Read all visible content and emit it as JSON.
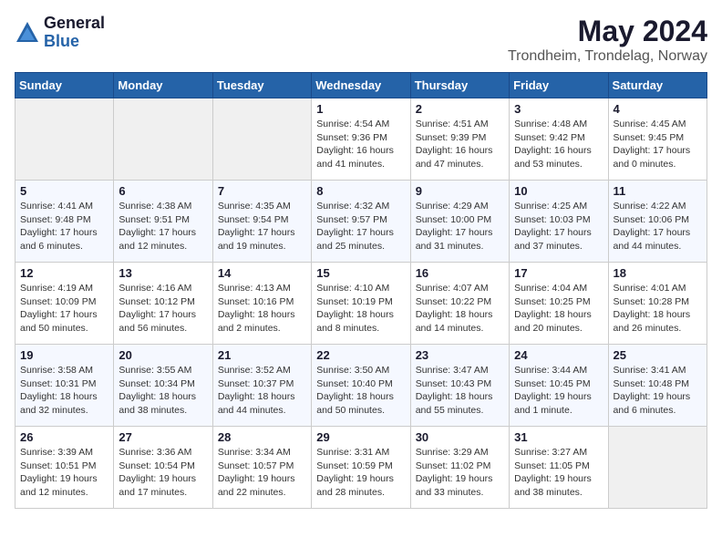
{
  "logo": {
    "general": "General",
    "blue": "Blue"
  },
  "header": {
    "month_year": "May 2024",
    "location": "Trondheim, Trondelag, Norway"
  },
  "days_of_week": [
    "Sunday",
    "Monday",
    "Tuesday",
    "Wednesday",
    "Thursday",
    "Friday",
    "Saturday"
  ],
  "weeks": [
    [
      {
        "day": "",
        "info": ""
      },
      {
        "day": "",
        "info": ""
      },
      {
        "day": "",
        "info": ""
      },
      {
        "day": "1",
        "info": "Sunrise: 4:54 AM\nSunset: 9:36 PM\nDaylight: 16 hours and 41 minutes."
      },
      {
        "day": "2",
        "info": "Sunrise: 4:51 AM\nSunset: 9:39 PM\nDaylight: 16 hours and 47 minutes."
      },
      {
        "day": "3",
        "info": "Sunrise: 4:48 AM\nSunset: 9:42 PM\nDaylight: 16 hours and 53 minutes."
      },
      {
        "day": "4",
        "info": "Sunrise: 4:45 AM\nSunset: 9:45 PM\nDaylight: 17 hours and 0 minutes."
      }
    ],
    [
      {
        "day": "5",
        "info": "Sunrise: 4:41 AM\nSunset: 9:48 PM\nDaylight: 17 hours and 6 minutes."
      },
      {
        "day": "6",
        "info": "Sunrise: 4:38 AM\nSunset: 9:51 PM\nDaylight: 17 hours and 12 minutes."
      },
      {
        "day": "7",
        "info": "Sunrise: 4:35 AM\nSunset: 9:54 PM\nDaylight: 17 hours and 19 minutes."
      },
      {
        "day": "8",
        "info": "Sunrise: 4:32 AM\nSunset: 9:57 PM\nDaylight: 17 hours and 25 minutes."
      },
      {
        "day": "9",
        "info": "Sunrise: 4:29 AM\nSunset: 10:00 PM\nDaylight: 17 hours and 31 minutes."
      },
      {
        "day": "10",
        "info": "Sunrise: 4:25 AM\nSunset: 10:03 PM\nDaylight: 17 hours and 37 minutes."
      },
      {
        "day": "11",
        "info": "Sunrise: 4:22 AM\nSunset: 10:06 PM\nDaylight: 17 hours and 44 minutes."
      }
    ],
    [
      {
        "day": "12",
        "info": "Sunrise: 4:19 AM\nSunset: 10:09 PM\nDaylight: 17 hours and 50 minutes."
      },
      {
        "day": "13",
        "info": "Sunrise: 4:16 AM\nSunset: 10:12 PM\nDaylight: 17 hours and 56 minutes."
      },
      {
        "day": "14",
        "info": "Sunrise: 4:13 AM\nSunset: 10:16 PM\nDaylight: 18 hours and 2 minutes."
      },
      {
        "day": "15",
        "info": "Sunrise: 4:10 AM\nSunset: 10:19 PM\nDaylight: 18 hours and 8 minutes."
      },
      {
        "day": "16",
        "info": "Sunrise: 4:07 AM\nSunset: 10:22 PM\nDaylight: 18 hours and 14 minutes."
      },
      {
        "day": "17",
        "info": "Sunrise: 4:04 AM\nSunset: 10:25 PM\nDaylight: 18 hours and 20 minutes."
      },
      {
        "day": "18",
        "info": "Sunrise: 4:01 AM\nSunset: 10:28 PM\nDaylight: 18 hours and 26 minutes."
      }
    ],
    [
      {
        "day": "19",
        "info": "Sunrise: 3:58 AM\nSunset: 10:31 PM\nDaylight: 18 hours and 32 minutes."
      },
      {
        "day": "20",
        "info": "Sunrise: 3:55 AM\nSunset: 10:34 PM\nDaylight: 18 hours and 38 minutes."
      },
      {
        "day": "21",
        "info": "Sunrise: 3:52 AM\nSunset: 10:37 PM\nDaylight: 18 hours and 44 minutes."
      },
      {
        "day": "22",
        "info": "Sunrise: 3:50 AM\nSunset: 10:40 PM\nDaylight: 18 hours and 50 minutes."
      },
      {
        "day": "23",
        "info": "Sunrise: 3:47 AM\nSunset: 10:43 PM\nDaylight: 18 hours and 55 minutes."
      },
      {
        "day": "24",
        "info": "Sunrise: 3:44 AM\nSunset: 10:45 PM\nDaylight: 19 hours and 1 minute."
      },
      {
        "day": "25",
        "info": "Sunrise: 3:41 AM\nSunset: 10:48 PM\nDaylight: 19 hours and 6 minutes."
      }
    ],
    [
      {
        "day": "26",
        "info": "Sunrise: 3:39 AM\nSunset: 10:51 PM\nDaylight: 19 hours and 12 minutes."
      },
      {
        "day": "27",
        "info": "Sunrise: 3:36 AM\nSunset: 10:54 PM\nDaylight: 19 hours and 17 minutes."
      },
      {
        "day": "28",
        "info": "Sunrise: 3:34 AM\nSunset: 10:57 PM\nDaylight: 19 hours and 22 minutes."
      },
      {
        "day": "29",
        "info": "Sunrise: 3:31 AM\nSunset: 10:59 PM\nDaylight: 19 hours and 28 minutes."
      },
      {
        "day": "30",
        "info": "Sunrise: 3:29 AM\nSunset: 11:02 PM\nDaylight: 19 hours and 33 minutes."
      },
      {
        "day": "31",
        "info": "Sunrise: 3:27 AM\nSunset: 11:05 PM\nDaylight: 19 hours and 38 minutes."
      },
      {
        "day": "",
        "info": ""
      }
    ]
  ]
}
